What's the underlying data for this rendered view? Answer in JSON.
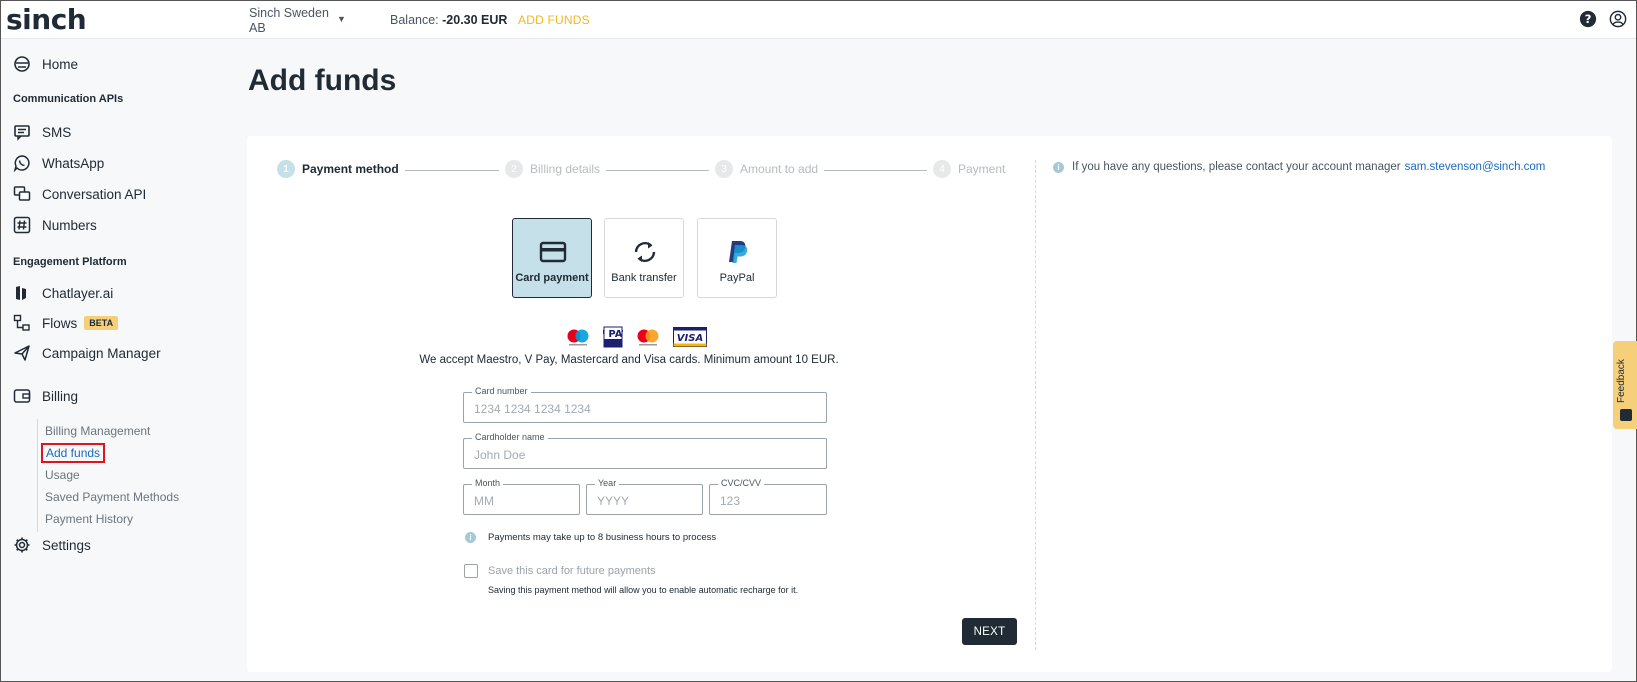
{
  "topbar": {
    "logo": "sinch",
    "account": "Sinch Sweden AB",
    "balance_label": "Balance:",
    "balance_value": "-20.30 EUR",
    "add_funds": "ADD FUNDS"
  },
  "sidebar": {
    "home": "Home",
    "section_comm": "Communication APIs",
    "sms": "SMS",
    "whatsapp": "WhatsApp",
    "conversation": "Conversation API",
    "numbers": "Numbers",
    "section_engagement": "Engagement Platform",
    "chatlayer": "Chatlayer.ai",
    "flows": "Flows",
    "flows_badge": "BETA",
    "campaign": "Campaign Manager",
    "billing": "Billing",
    "billing_sub": [
      "Billing Management",
      "Add funds",
      "Usage",
      "Saved Payment Methods",
      "Payment History"
    ],
    "settings": "Settings"
  },
  "main": {
    "title": "Add funds",
    "steps": [
      {
        "num": "1",
        "label": "Payment method"
      },
      {
        "num": "2",
        "label": "Billing details"
      },
      {
        "num": "3",
        "label": "Amount to add"
      },
      {
        "num": "4",
        "label": "Payment"
      }
    ],
    "info_text": "If you have any questions, please contact your account manager",
    "info_email": "sam.stevenson@sinch.com",
    "payment_options": [
      "Card payment",
      "Bank transfer",
      "PayPal"
    ],
    "card_brand_labels": {
      "vpay": "V PAY",
      "visa": "VISA"
    },
    "accept_text": "We accept Maestro, V Pay, Mastercard and Visa cards. Minimum amount 10 EUR.",
    "fields": {
      "card_number_label": "Card number",
      "card_number_placeholder": "1234 1234 1234 1234",
      "holder_label": "Cardholder name",
      "holder_placeholder": "John Doe",
      "month_label": "Month",
      "month_placeholder": "MM",
      "year_label": "Year",
      "year_placeholder": "YYYY",
      "cvc_label": "CVC/CVV",
      "cvc_placeholder": "123"
    },
    "processing_note": "Payments may take up to 8 business hours to process",
    "save_card_label": "Save this card for future payments",
    "save_card_sub": "Saving this payment method will allow you to enable automatic recharge for it.",
    "next_button": "NEXT"
  },
  "feedback": "Feedback",
  "colors": {
    "accent": "#f0b72b",
    "selected": "#c5e0e8",
    "dark": "#212b36",
    "link": "#1a6bc0"
  }
}
